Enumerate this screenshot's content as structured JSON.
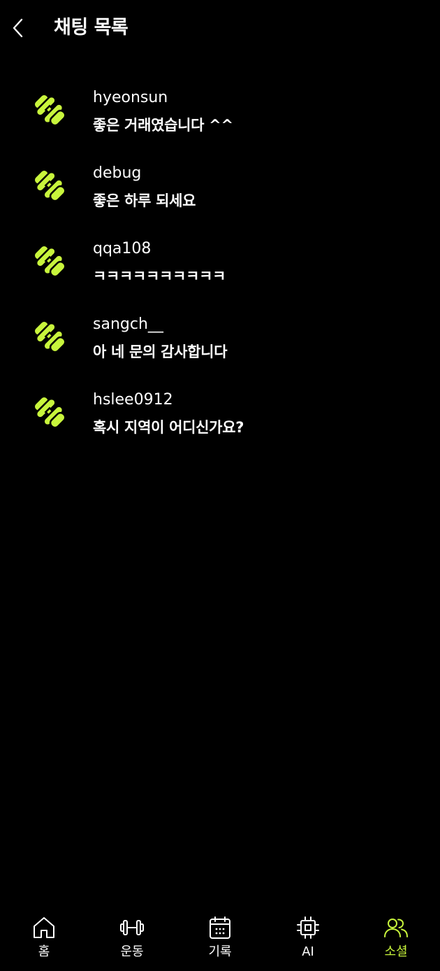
{
  "header": {
    "title": "채팅 목록",
    "back_icon": "chevron-left-icon"
  },
  "chats": [
    {
      "username": "hyeonsun",
      "message": "좋은 거래였습니다 ^^",
      "avatar_icon": "dumbbell-icon"
    },
    {
      "username": "debug",
      "message": "좋은 하루 되세요",
      "avatar_icon": "dumbbell-icon"
    },
    {
      "username": "qqa108",
      "message": "ㅋㅋㅋㅋㅋㅋㅋㅋㅋㅋ",
      "avatar_icon": "dumbbell-icon"
    },
    {
      "username": "sangch__",
      "message": "아 네 문의 감사합니다",
      "avatar_icon": "dumbbell-icon"
    },
    {
      "username": "hslee0912",
      "message": "혹시 지역이 어디신가요?",
      "avatar_icon": "dumbbell-icon"
    }
  ],
  "tabbar": {
    "items": [
      {
        "label": "홈",
        "icon": "home-icon",
        "active": false
      },
      {
        "label": "운동",
        "icon": "dumbbell-icon",
        "active": false
      },
      {
        "label": "기록",
        "icon": "calendar-icon",
        "active": false
      },
      {
        "label": "AI",
        "icon": "chip-icon",
        "active": false
      },
      {
        "label": "소셜",
        "icon": "users-icon",
        "active": true
      }
    ]
  },
  "colors": {
    "background": "#000000",
    "text": "#ffffff",
    "accent": "#c8f53c"
  }
}
